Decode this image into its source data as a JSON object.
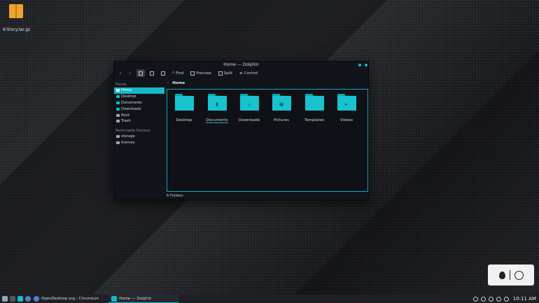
{
  "desktop": {
    "file_label": "K-Story.tar.gz"
  },
  "window": {
    "title": "Home — Dolphin",
    "toolbar": {
      "find": "Find",
      "preview": "Preview",
      "split": "Split",
      "control": "Control"
    },
    "breadcrumb": "Home",
    "sidebar": {
      "places_header": "Places",
      "places": [
        "Home",
        "Desktop",
        "Documents",
        "Downloads",
        "Root",
        "Trash"
      ],
      "devices_header": "Removable Devices",
      "devices": [
        "storage",
        "themes"
      ]
    },
    "folders": [
      "Desktop",
      "Documents",
      "Downloads",
      "Pictures",
      "Templates",
      "Videos"
    ],
    "status": "6 Folders"
  },
  "taskbar": {
    "tasks": [
      "OpenDesktop.org - Chromium",
      "Home — Dolphin"
    ],
    "clock": "10:11 AM"
  },
  "colors": {
    "accent": "#16b9c7"
  }
}
